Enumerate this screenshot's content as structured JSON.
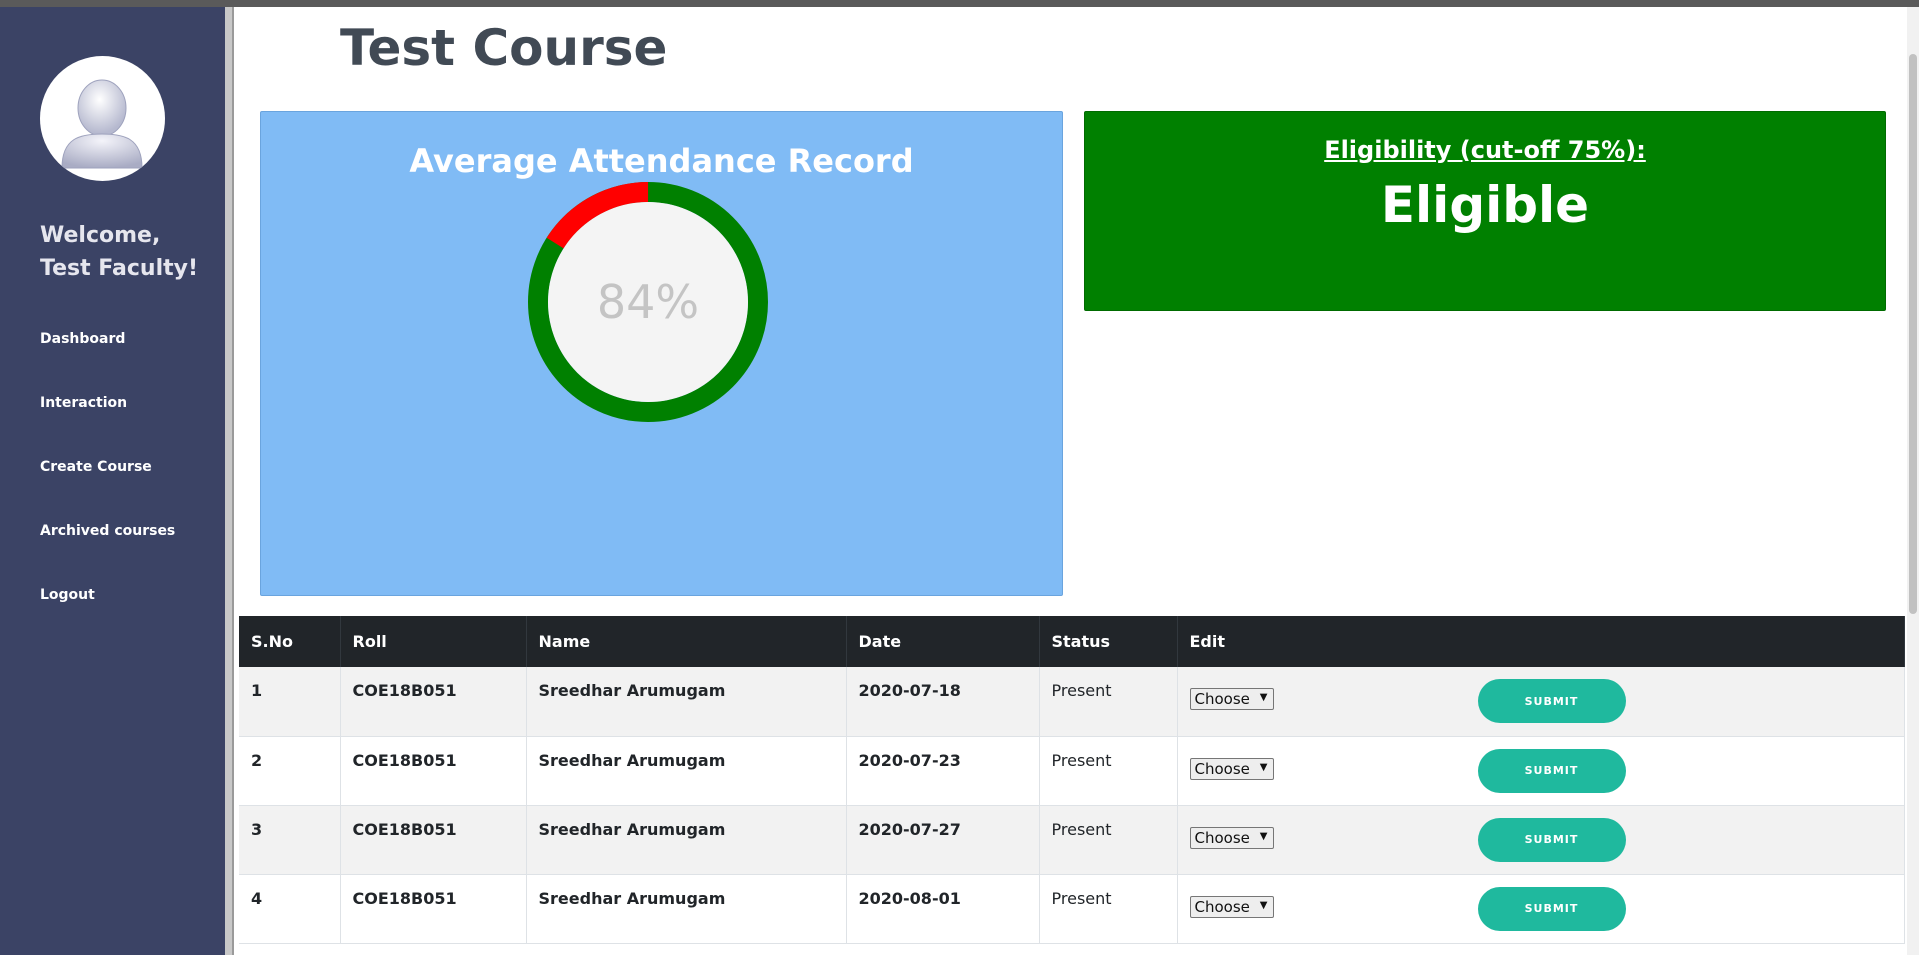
{
  "sidebar": {
    "welcome_line1": "Welcome,",
    "welcome_line2": "Test Faculty!",
    "items": [
      {
        "label": "Dashboard"
      },
      {
        "label": "Interaction"
      },
      {
        "label": "Create Course"
      },
      {
        "label": "Archived courses"
      },
      {
        "label": "Logout"
      }
    ]
  },
  "page": {
    "title": "Test Course"
  },
  "attendance": {
    "title": "Average Attendance Record",
    "percent_label": "84%",
    "present_fraction": 0.84,
    "colors": {
      "present": "#008000",
      "absent": "#ff0000",
      "center": "#f4f4f4"
    }
  },
  "eligibility": {
    "heading": "Eligibility (cut-off 75%):",
    "value": "Eligible",
    "color": "#008000"
  },
  "table": {
    "headers": [
      "S.No",
      "Roll",
      "Name",
      "Date",
      "Status",
      "Edit"
    ],
    "rows": [
      {
        "sno": "1",
        "roll": "COE18B051",
        "name": "Sreedhar Arumugam",
        "date": "2020-07-18",
        "status": "Present",
        "select": "Choose",
        "button": "SUBMIT"
      },
      {
        "sno": "2",
        "roll": "COE18B051",
        "name": "Sreedhar Arumugam",
        "date": "2020-07-23",
        "status": "Present",
        "select": "Choose",
        "button": "SUBMIT"
      },
      {
        "sno": "3",
        "roll": "COE18B051",
        "name": "Sreedhar Arumugam",
        "date": "2020-07-27",
        "status": "Present",
        "select": "Choose",
        "button": "SUBMIT"
      },
      {
        "sno": "4",
        "roll": "COE18B051",
        "name": "Sreedhar Arumugam",
        "date": "2020-08-01",
        "status": "Present",
        "select": "Choose",
        "button": "SUBMIT"
      }
    ]
  },
  "colors": {
    "sidebar_bg": "#3b4365",
    "submit_bg": "#1fb99e",
    "table_header_bg": "#212529"
  }
}
